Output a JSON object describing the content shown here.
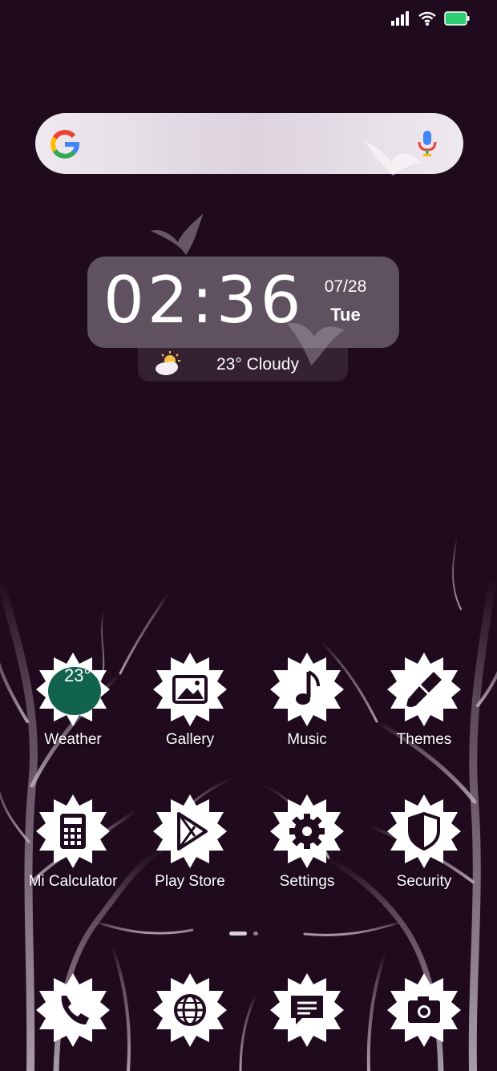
{
  "status_bar": {
    "icons": [
      "signal-icon",
      "wifi-icon",
      "battery-icon"
    ],
    "battery_color": "#2ecc71"
  },
  "search": {
    "logo": "google-logo-icon",
    "mic": "mic-icon"
  },
  "clock": {
    "time": "02:36",
    "date": "07/28",
    "day": "Tue"
  },
  "weather_widget": {
    "text": "23° Cloudy",
    "icon": "partly-cloudy-icon"
  },
  "apps_row1": [
    {
      "label": "Weather",
      "icon": "weather-icon",
      "badge": "23°"
    },
    {
      "label": "Gallery",
      "icon": "gallery-icon"
    },
    {
      "label": "Music",
      "icon": "music-icon"
    },
    {
      "label": "Themes",
      "icon": "paintbrush-icon"
    }
  ],
  "apps_row2": [
    {
      "label": "Mi Calculator",
      "icon": "calculator-icon"
    },
    {
      "label": "Play Store",
      "icon": "play-store-icon"
    },
    {
      "label": "Settings",
      "icon": "gear-icon"
    },
    {
      "label": "Security",
      "icon": "shield-icon"
    }
  ],
  "dock": [
    {
      "icon": "phone-icon"
    },
    {
      "icon": "browser-globe-icon"
    },
    {
      "icon": "messages-icon"
    },
    {
      "icon": "camera-icon"
    }
  ],
  "colors": {
    "background": "#1f0a1e",
    "icon_fill": "#ffffff",
    "icon_glyph": "#1f0a1e",
    "weather_badge": "#12634e"
  }
}
